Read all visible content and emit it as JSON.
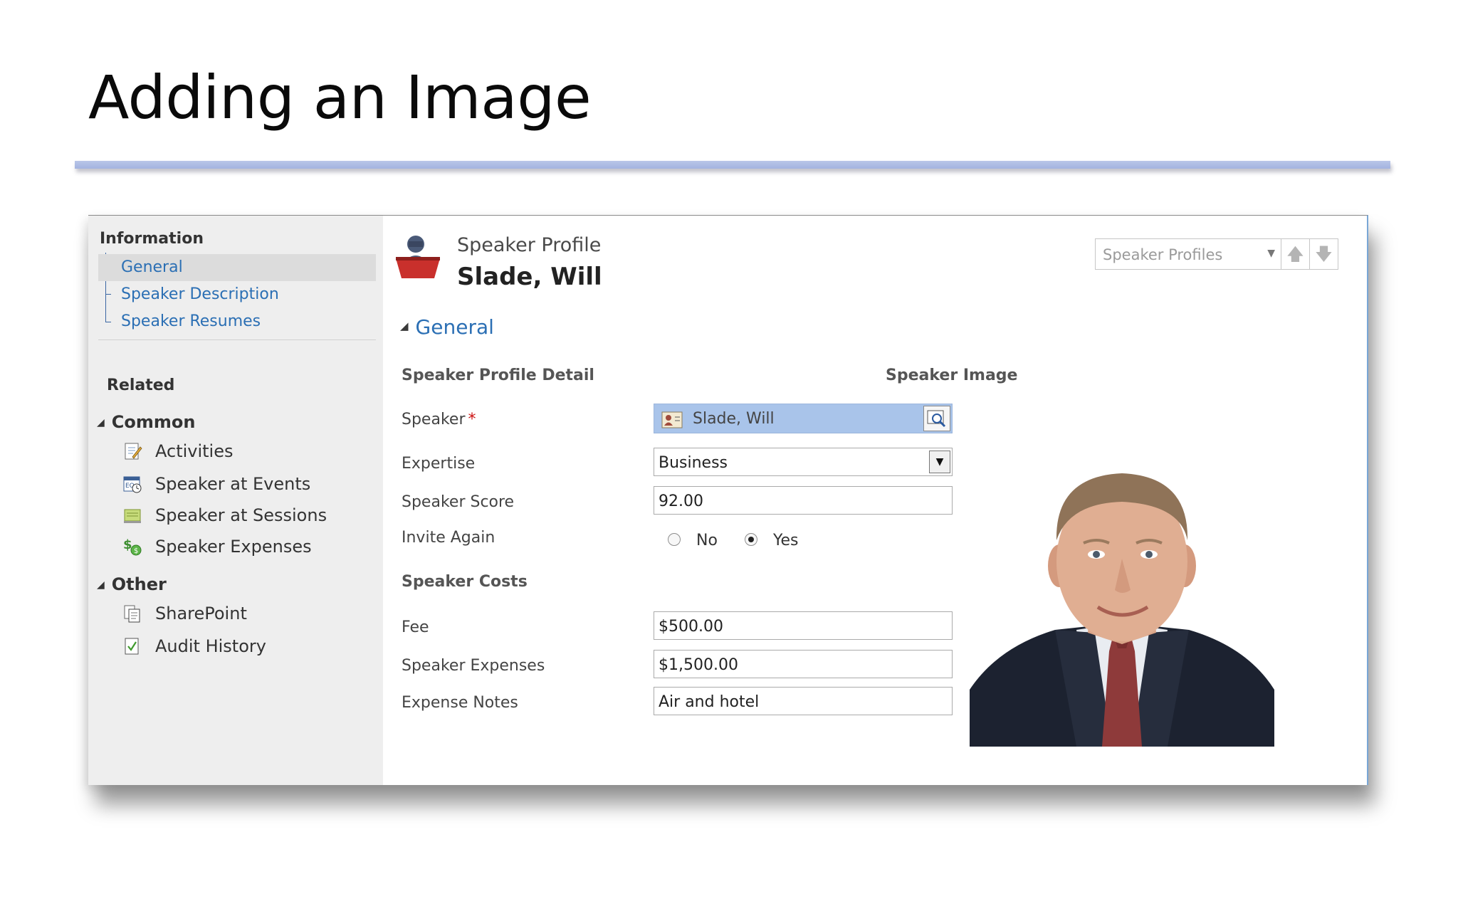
{
  "slide": {
    "title": "Adding an Image"
  },
  "nav": {
    "information_heading": "Information",
    "sub_items": [
      {
        "label": "General",
        "selected": true
      },
      {
        "label": "Speaker Description"
      },
      {
        "label": "Speaker Resumes"
      }
    ],
    "related_heading": "Related",
    "groups": [
      {
        "label": "Common",
        "items": [
          {
            "label": "Activities",
            "icon": "activities-icon"
          },
          {
            "label": "Speaker at Events",
            "icon": "calendar-icon"
          },
          {
            "label": "Speaker at Sessions",
            "icon": "session-icon"
          },
          {
            "label": "Speaker Expenses",
            "icon": "expenses-icon"
          }
        ]
      },
      {
        "label": "Other",
        "items": [
          {
            "label": "SharePoint",
            "icon": "sharepoint-icon"
          },
          {
            "label": "Audit History",
            "icon": "audit-history-icon"
          }
        ]
      }
    ]
  },
  "header": {
    "entity_type": "Speaker Profile",
    "record_name": "Slade, Will",
    "view_selector": "Speaker Profiles"
  },
  "form": {
    "section_title": "General",
    "detail_heading": "Speaker Profile Detail",
    "image_heading": "Speaker Image",
    "costs_heading": "Speaker Costs",
    "fields": {
      "speaker": {
        "label": "Speaker",
        "required_mark": "*",
        "value": "Slade, Will"
      },
      "expertise": {
        "label": "Expertise",
        "value": "Business"
      },
      "score": {
        "label": "Speaker Score",
        "value": "92.00"
      },
      "invite_again": {
        "label": "Invite Again",
        "options": [
          "No",
          "Yes"
        ],
        "selected": "Yes"
      },
      "fee": {
        "label": "Fee",
        "value": "$500.00"
      },
      "expenses": {
        "label": "Speaker Expenses",
        "value": "$1,500.00"
      },
      "expense_notes": {
        "label": "Expense Notes",
        "value": "Air and hotel"
      }
    }
  },
  "colors": {
    "link_blue": "#2b6fb4",
    "lookup_bg": "#a9c4ea",
    "nav_bg": "#eeeeee",
    "required_red": "#cc1111"
  }
}
